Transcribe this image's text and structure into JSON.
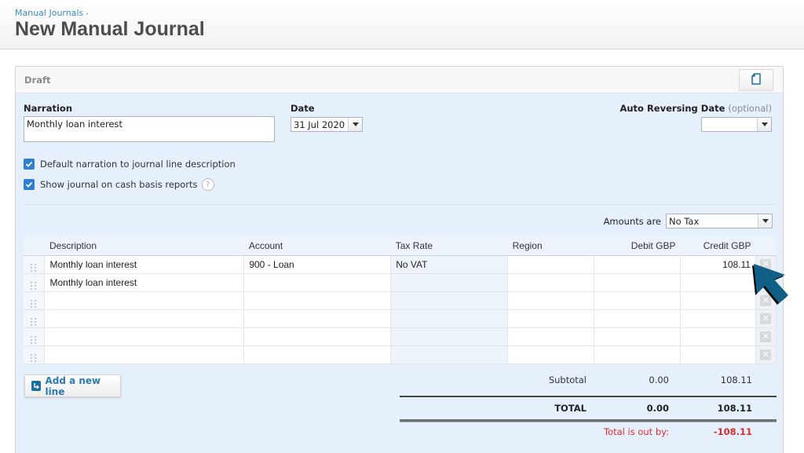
{
  "header": {
    "breadcrumb": "Manual Journals",
    "breadcrumb_sep": "›",
    "title": "New Manual Journal"
  },
  "panel": {
    "status": "Draft",
    "copy_icon": "document-icon"
  },
  "form": {
    "narration_label": "Narration",
    "narration_value": "Monthly loan interest",
    "date_label": "Date",
    "date_value": "31 Jul 2020",
    "auto_reversing_label": "Auto Reversing Date",
    "auto_reversing_optional": "(optional)",
    "auto_reversing_value": "",
    "checkboxes": [
      {
        "label": "Default narration to journal line description",
        "checked": true
      },
      {
        "label": "Show journal on cash basis reports",
        "checked": true
      }
    ],
    "help_glyph": "?",
    "amounts_label": "Amounts are",
    "amounts_value": "No Tax"
  },
  "table": {
    "columns": [
      "Description",
      "Account",
      "Tax Rate",
      "Region",
      "Debit GBP",
      "Credit GBP"
    ],
    "rows": [
      {
        "description": "Monthly loan interest",
        "account": "900 - Loan",
        "tax_rate": "No VAT",
        "region": "",
        "debit": "",
        "credit": "108.11"
      },
      {
        "description": "Monthly loan interest",
        "account": "",
        "tax_rate": "",
        "region": "",
        "debit": "",
        "credit": ""
      },
      {
        "description": "",
        "account": "",
        "tax_rate": "",
        "region": "",
        "debit": "",
        "credit": ""
      },
      {
        "description": "",
        "account": "",
        "tax_rate": "",
        "region": "",
        "debit": "",
        "credit": ""
      },
      {
        "description": "",
        "account": "",
        "tax_rate": "",
        "region": "",
        "debit": "",
        "credit": ""
      },
      {
        "description": "",
        "account": "",
        "tax_rate": "",
        "region": "",
        "debit": "",
        "credit": ""
      }
    ],
    "delete_glyph": "✕"
  },
  "actions": {
    "add_line_label": "Add a new line"
  },
  "totals": {
    "subtotal_label": "Subtotal",
    "subtotal_debit": "0.00",
    "subtotal_credit": "108.11",
    "total_label": "TOTAL",
    "total_debit": "0.00",
    "total_credit": "108.11",
    "out_by_label": "Total is out by:",
    "out_by_value": "-108.11"
  },
  "colors": {
    "accent": "#2a7cb3",
    "panel_bg": "#e6f0fc",
    "error": "#d32f2f",
    "cursor": "#0f5f86"
  }
}
